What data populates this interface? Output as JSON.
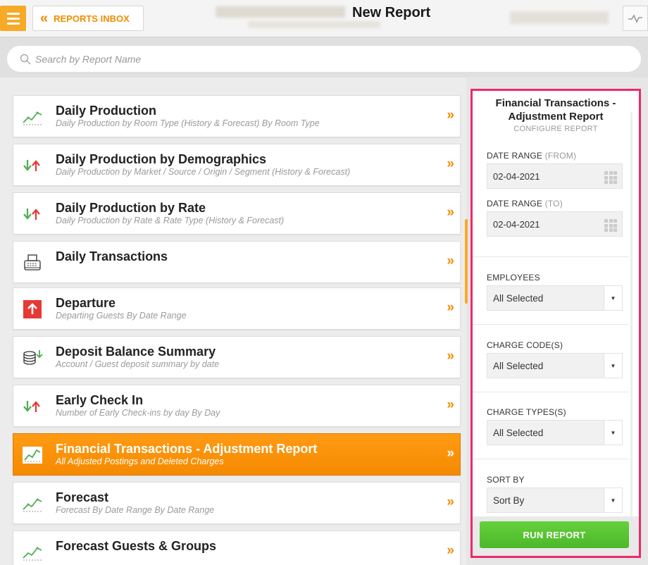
{
  "header": {
    "title": "New Report",
    "inbox_label": "REPORTS INBOX"
  },
  "search": {
    "placeholder": "Search by Report Name"
  },
  "reports": [
    {
      "name": "Daily Production",
      "desc": "Daily Production by Room Type (History & Forecast) By Room Type",
      "icon": "trend-chart-icon"
    },
    {
      "name": "Daily Production by Demographics",
      "desc": "Daily Production by Market / Source / Origin / Segment (History & Forecast)",
      "icon": "up-down-arrows-icon"
    },
    {
      "name": "Daily Production by Rate",
      "desc": "Daily Production by Rate & Rate Type (History & Forecast)",
      "icon": "up-down-arrows-icon"
    },
    {
      "name": "Daily Transactions",
      "desc": "",
      "icon": "cash-register-icon"
    },
    {
      "name": "Departure",
      "desc": "Departing Guests By Date Range",
      "icon": "red-up-arrow-icon"
    },
    {
      "name": "Deposit Balance Summary",
      "desc": "Account / Guest deposit summary by date",
      "icon": "coin-stack-icon"
    },
    {
      "name": "Early Check In",
      "desc": "Number of Early Check-ins by day By Day",
      "icon": "up-down-arrows-icon"
    },
    {
      "name": "Financial Transactions - Adjustment Report",
      "desc": "All Adjusted Postings and Deleted Charges",
      "icon": "trend-chart-icon",
      "active": true
    },
    {
      "name": "Forecast",
      "desc": "Forecast By Date Range By Date Range",
      "icon": "trend-chart-icon"
    },
    {
      "name": "Forecast Guests & Groups",
      "desc": "",
      "icon": "trend-chart-icon"
    }
  ],
  "config": {
    "title": "Financial Transactions - Adjustment Report",
    "subtitle": "CONFIGURE REPORT",
    "date_from_label": "DATE RANGE",
    "date_from_suffix": "(FROM)",
    "date_from": "02-04-2021",
    "date_to_label": "DATE RANGE",
    "date_to_suffix": "(TO)",
    "date_to": "02-04-2021",
    "employees_label": "EMPLOYEES",
    "employees_value": "All Selected",
    "charge_codes_label": "CHARGE CODE(S)",
    "charge_codes_value": "All Selected",
    "charge_types_label": "CHARGE TYPES(S)",
    "charge_types_value": "All Selected",
    "sort_label": "SORT BY",
    "sort_value": "Sort By",
    "run_label": "RUN REPORT"
  },
  "colors": {
    "accent": "#f28c00",
    "highlight_border": "#f0286b",
    "run_button": "#5cc534"
  }
}
